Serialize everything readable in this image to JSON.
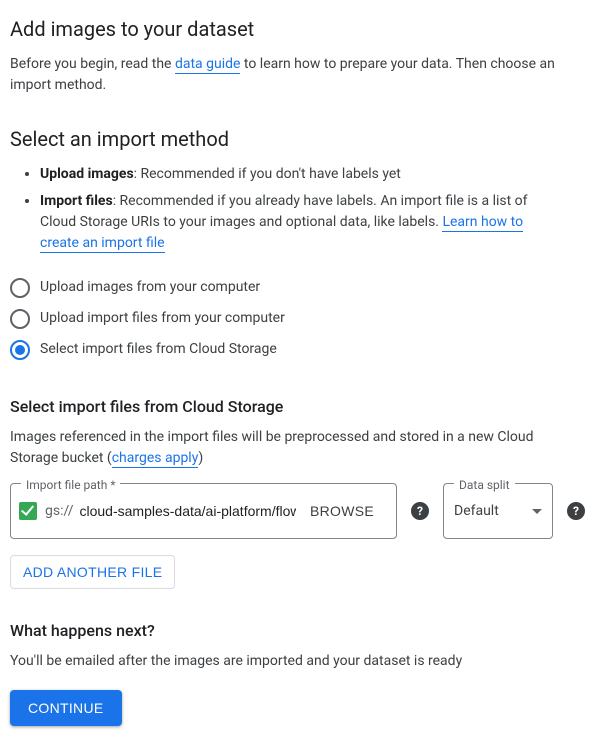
{
  "section1": {
    "title": "Add images to your dataset",
    "intro_before": "Before you begin, read the ",
    "intro_link": "data guide",
    "intro_after": " to learn how to prepare your data. Then choose an import method."
  },
  "section2": {
    "title": "Select an import method",
    "bullet1_strong": "Upload images",
    "bullet1_rest": ": Recommended if you don't have labels yet",
    "bullet2_strong": "Import files",
    "bullet2_rest_a": ": Recommended if you already have labels. An import file is a list of Cloud Storage URIs to your images and optional data, like labels. ",
    "bullet2_link": "Learn how to create an import file"
  },
  "radios": {
    "opt1": "Upload images from your computer",
    "opt2": "Upload import files from your computer",
    "opt3": "Select import files from Cloud Storage"
  },
  "import_section": {
    "heading": "Select import files from Cloud Storage",
    "desc_a": "Images referenced in the import files will be preprocessed and stored in a new Cloud Storage bucket (",
    "desc_link": "charges apply",
    "desc_b": ")"
  },
  "path_field": {
    "label": "Import file path *",
    "prefix": "gs://",
    "value": "cloud-samples-data/ai-platform/flowers/flow",
    "browse": "BROWSE"
  },
  "split_field": {
    "label": "Data split",
    "value": "Default"
  },
  "help_glyph": "?",
  "add_file_btn": "ADD ANOTHER FILE",
  "next_section": {
    "heading": "What happens next?",
    "desc": "You'll be emailed after the images are imported and your dataset is ready"
  },
  "continue_btn": "CONTINUE"
}
